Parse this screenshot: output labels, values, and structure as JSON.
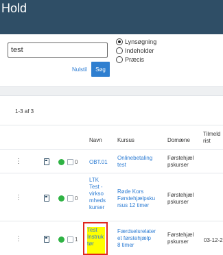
{
  "header": {
    "title": "Hold"
  },
  "search": {
    "value": "test",
    "reset_label": "Nulstil",
    "search_label": "Søg",
    "modes": [
      "Lynsøgning",
      "Indeholder",
      "Præcis"
    ],
    "selected_mode": "Lynsøgning"
  },
  "results": {
    "count_label": "1-3 af 3"
  },
  "table": {
    "headers": [
      "Navn",
      "Kursus",
      "Domæne",
      "Tilmeld\nrist"
    ],
    "rows": [
      {
        "number": "0",
        "name": "OBT.01",
        "course": "Onlinebetaling\ntest",
        "domain": "Førstehjæl\npskurser",
        "date": ""
      },
      {
        "number": "0",
        "name": "LTK\nTest -\nvirkso\nmheds\nkurser",
        "course": "Røde Kors\nFørstehjælpsku\nrsus 12 timer",
        "domain": "Førstehjæl\npskurser",
        "date": ""
      },
      {
        "number": "1",
        "name": "Test\nInstruk\ntør",
        "course": "Færdselsrelater\net førstehjælp\n8 timer",
        "domain": "Førstehjæl\npskurser",
        "date": "03-12-2"
      }
    ]
  },
  "colors": {
    "header_bg": "#2f4e66",
    "link": "#2b7bd3",
    "status_active": "#2fb344",
    "highlight": "#ffff00",
    "annotation": "#e0261d"
  },
  "icons": {
    "row_menu": "kebab-menu-icon",
    "row_doc": "document-icon",
    "row_status": "status-dot-icon",
    "row_calendar": "calendar-icon"
  }
}
